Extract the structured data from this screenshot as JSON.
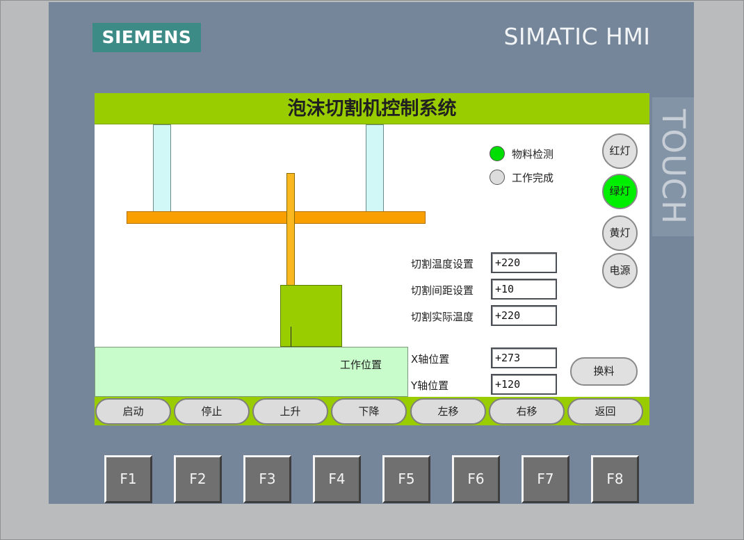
{
  "device": {
    "brand": "SIEMENS",
    "product": "SIMATIC HMI",
    "touch_label": "TOUCH"
  },
  "screen": {
    "title": "泡沫切割机控制系统",
    "work_area_label": "工作位置",
    "indicators": [
      {
        "label": "物料检测",
        "state": "on",
        "color": "#00dd00"
      },
      {
        "label": "工作完成",
        "state": "off",
        "color": "#dcdcdc"
      }
    ],
    "side_buttons": [
      {
        "label": "红灯",
        "color": "#e0e0e0"
      },
      {
        "label": "绿灯",
        "color": "#00ee00"
      },
      {
        "label": "黄灯",
        "color": "#e0e0e0"
      },
      {
        "label": "电源",
        "color": "#e0e0e0"
      }
    ],
    "params": [
      {
        "label": "切割温度设置",
        "value": "+220"
      },
      {
        "label": "切割间距设置",
        "value": "+10"
      },
      {
        "label": "切割实际温度",
        "value": "+220"
      }
    ],
    "axes": [
      {
        "label": "X轴位置",
        "value": "+273"
      },
      {
        "label": "Y轴位置",
        "value": "+120"
      }
    ],
    "change_button": "换料",
    "bottom_buttons": [
      "启动",
      "停止",
      "上升",
      "下降",
      "左移",
      "右移",
      "返回"
    ]
  },
  "function_keys": [
    "F1",
    "F2",
    "F3",
    "F4",
    "F5",
    "F6",
    "F7",
    "F8"
  ],
  "colors": {
    "title_bar": "#9acd00",
    "bezel": "#75869a",
    "beam": "#f9a000",
    "block": "#9acd00",
    "work_area": "#c8fccb"
  }
}
